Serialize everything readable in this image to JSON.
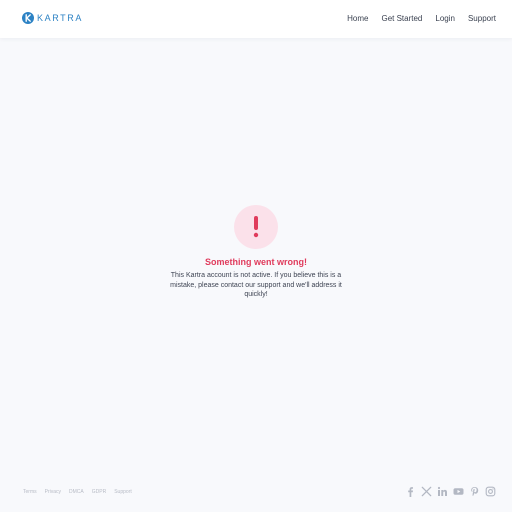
{
  "header": {
    "logo_text": "KARTRA",
    "nav": [
      "Home",
      "Get Started",
      "Login",
      "Support"
    ]
  },
  "error": {
    "title": "Something went wrong!",
    "message": "This Kartra account is not active. If you believe this is a mistake, please contact our support and we'll address it quickly!"
  },
  "footer": {
    "links": [
      "Terms",
      "Privacy",
      "DMCA",
      "GDPR",
      "Support"
    ],
    "socials": [
      "facebook-icon",
      "x-icon",
      "linkedin-icon",
      "youtube-icon",
      "pinterest-icon",
      "instagram-icon"
    ]
  },
  "colors": {
    "brand": "#2c82c4",
    "error": "#e03b5c",
    "error_bg": "#fbe1ea",
    "background": "#f8f9fc"
  }
}
